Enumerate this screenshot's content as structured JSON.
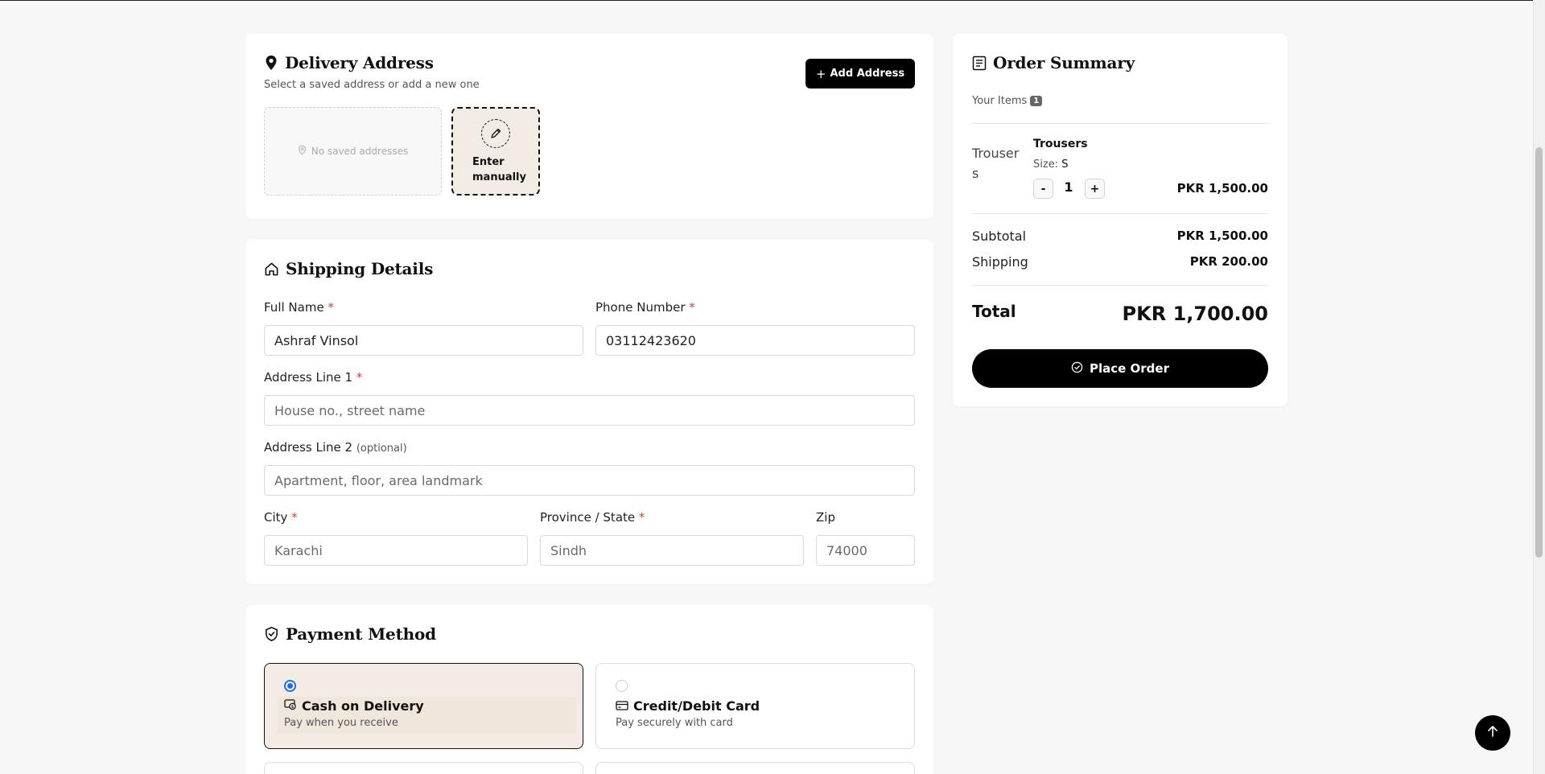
{
  "delivery": {
    "title": "Delivery Address",
    "subtitle": "Select a saved address or add a new one",
    "add_button": "Add Address",
    "no_saved": "No saved addresses",
    "enter_manually": "Enter manually"
  },
  "shipping": {
    "title": "Shipping Details",
    "full_name": {
      "label": "Full Name",
      "required": "*",
      "value": "Ashraf Vinsol"
    },
    "phone": {
      "label": "Phone Number",
      "required": "*",
      "value": "03112423620"
    },
    "address1": {
      "label": "Address Line 1",
      "required": "*",
      "placeholder": "House no., street name"
    },
    "address2": {
      "label": "Address Line 2",
      "optional": "(optional)",
      "placeholder": "Apartment, floor, area landmark"
    },
    "city": {
      "label": "City",
      "required": "*",
      "placeholder": "Karachi"
    },
    "province": {
      "label": "Province / State",
      "required": "*",
      "placeholder": "Sindh"
    },
    "zip": {
      "label": "Zip",
      "placeholder": "74000"
    }
  },
  "payment": {
    "title": "Payment Method",
    "options": [
      {
        "title": "Cash on Delivery",
        "subtitle": "Pay when you receive",
        "selected": true,
        "icon": "cash-icon"
      },
      {
        "title": "Credit/Debit Card",
        "subtitle": "Pay securely with card",
        "selected": false,
        "icon": "card-icon"
      }
    ]
  },
  "summary": {
    "title": "Order Summary",
    "items_label": "Your Items",
    "items_count": "1",
    "item": {
      "name": "Trousers",
      "image_alt": "Trousers",
      "size_label": "Size:",
      "size_value": "S",
      "quantity": "1",
      "minus": "-",
      "plus": "+",
      "price": "PKR 1,500.00"
    },
    "subtotal_label": "Subtotal",
    "subtotal_value": "PKR 1,500.00",
    "shipping_label": "Shipping",
    "shipping_value": "PKR 200.00",
    "total_label": "Total",
    "total_value": "PKR 1,700.00",
    "place_order": "Place Order"
  },
  "colors": {
    "accent": "#000000",
    "selected_bg": "#f3ece4",
    "radio_blue": "#1a6ee8",
    "required_red": "#e03b3b"
  }
}
